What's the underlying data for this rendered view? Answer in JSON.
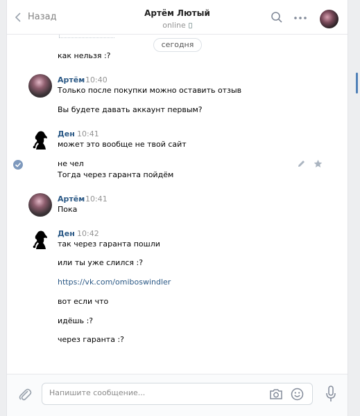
{
  "header": {
    "back_label": "Назад",
    "title": "Артём Лютый",
    "status": "online"
  },
  "feed": {
    "previous_message": "как нельзя :?",
    "date_divider": "сегодня",
    "groups": [
      {
        "author": "Артём",
        "time": "10:40",
        "avatar": "artem",
        "lines": [
          "Только после покупки можно оставить отзыв",
          "Вы будете давать аккаунт первым?"
        ]
      },
      {
        "author": "Ден",
        "time": "10:41",
        "avatar": "den",
        "lines": [
          "может это вообще не твой сайт",
          "не чел",
          "Тогда через гаранта пойдём"
        ]
      },
      {
        "author": "Артём",
        "time": "10:41",
        "avatar": "artem",
        "lines": [
          "Пока"
        ]
      },
      {
        "author": "Ден",
        "time": "10:42",
        "avatar": "den",
        "lines": [
          "так через гаранта пошли",
          "или ты уже слился :?",
          "https://vk.com/omiboswindler",
          "вот если что",
          "идёшь :?",
          "через гаранта :?"
        ]
      }
    ]
  },
  "composer": {
    "placeholder": "Напишите сообщение..."
  },
  "icons": {
    "back": "chevron-left-icon",
    "search": "search-icon",
    "more": "more-icon",
    "attach": "paperclip-icon",
    "camera": "camera-icon",
    "emoji": "emoji-icon",
    "mic": "microphone-icon",
    "edit": "pencil-icon",
    "star": "star-icon",
    "check": "check-icon"
  },
  "colors": {
    "link": "#2a5885",
    "accent": "#5181b8",
    "meta": "#939393"
  }
}
